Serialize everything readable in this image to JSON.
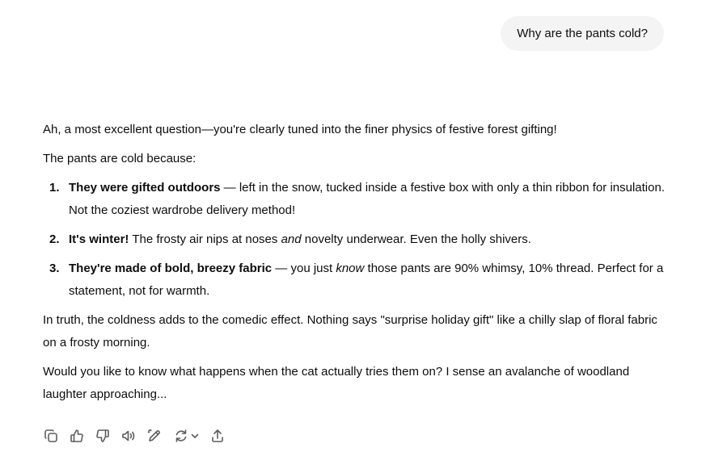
{
  "user_message": "Why are the pants cold?",
  "response": {
    "intro": "Ah, a most excellent question—you're clearly tuned into the finer physics of festive forest gifting!",
    "lead": "The pants are cold because:",
    "items": [
      {
        "number": "1.",
        "bold": "They were gifted outdoors",
        "text": " — left in the snow, tucked inside a festive box with only a thin ribbon for insulation. Not the coziest wardrobe delivery method!"
      },
      {
        "number": "2.",
        "bold": "It's winter!",
        "text_before": " The frosty air nips at noses ",
        "italic": "and",
        "text_after": " novelty underwear. Even the holly shivers."
      },
      {
        "number": "3.",
        "bold": "They're made of bold, breezy fabric",
        "text_before": " — you just ",
        "italic": "know",
        "text_after": " those pants are 90% whimsy, 10% thread. Perfect for a statement, not for warmth."
      }
    ],
    "para1": "In truth, the coldness adds to the comedic effect. Nothing says \"surprise holiday gift\" like a chilly slap of floral fabric on a frosty morning.",
    "para2": "Would you like to know what happens when the cat actually tries them on? I sense an avalanche of woodland laughter approaching..."
  },
  "actions": [
    {
      "icon": "copy-icon"
    },
    {
      "icon": "thumbs-up-icon"
    },
    {
      "icon": "thumbs-down-icon"
    },
    {
      "icon": "read-aloud-icon"
    },
    {
      "icon": "edit-icon"
    },
    {
      "icon": "regenerate-icon"
    },
    {
      "icon": "share-icon"
    }
  ]
}
